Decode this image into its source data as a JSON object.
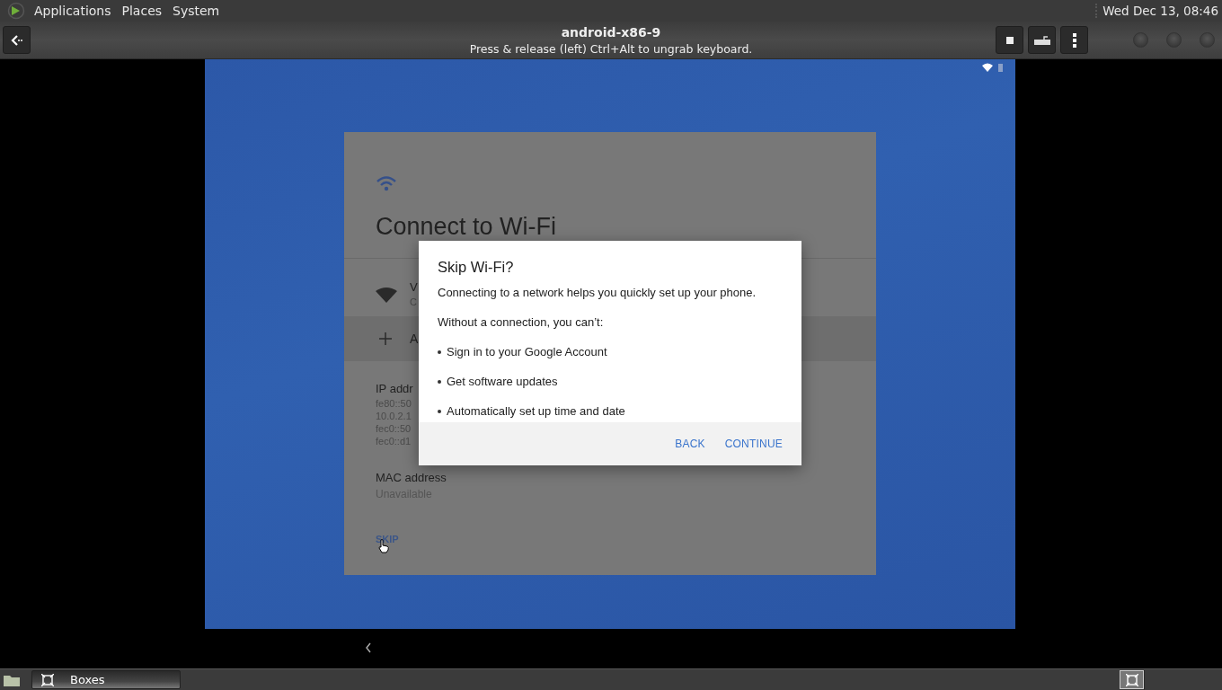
{
  "top_panel": {
    "menus": [
      "Applications",
      "Places",
      "System"
    ],
    "clock": "Wed Dec 13, 08:46"
  },
  "header": {
    "title": "android-x86-9",
    "subtitle": "Press & release (left) Ctrl+Alt to ungrab keyboard."
  },
  "setup_card": {
    "title": "Connect to Wi-Fi",
    "network": {
      "name": "V",
      "status": "C"
    },
    "add_network": "A",
    "ip_label": "IP addr",
    "ip_values": [
      "fe80::50",
      "10.0.2.1",
      "fec0::50",
      "fec0::d1"
    ],
    "mac_label": "MAC address",
    "mac_value": "Unavailable",
    "skip": "SKIP"
  },
  "dialog": {
    "title": "Skip Wi-Fi?",
    "body": "Connecting to a network helps you quickly set up your phone.",
    "intro": "Without a connection, you can’t:",
    "bullets": [
      "Sign in to your Google Account",
      "Get software updates",
      "Automatically set up time and date"
    ],
    "buttons": [
      "BACK",
      "CONTINUE"
    ]
  },
  "taskbar": {
    "items": [
      {
        "label": "Boxes",
        "selected": true
      }
    ]
  }
}
